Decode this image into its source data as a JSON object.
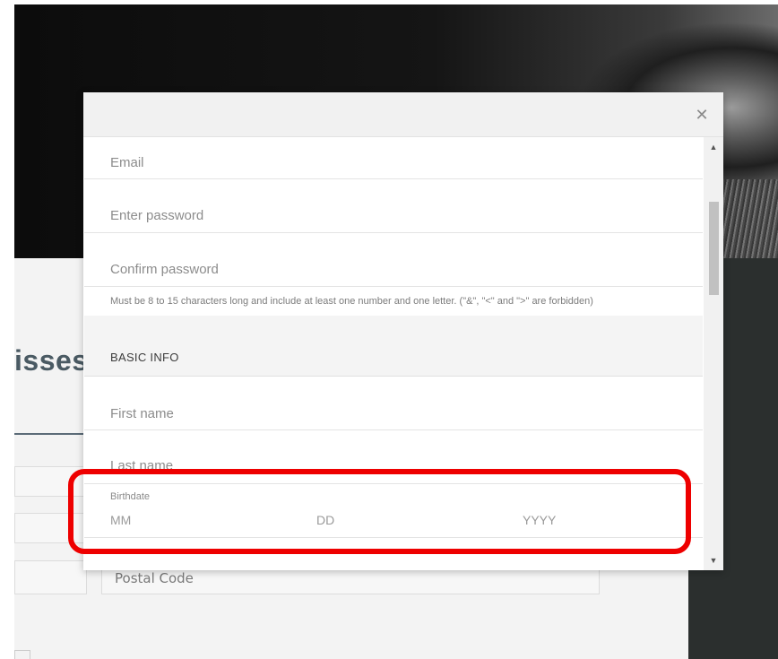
{
  "background": {
    "heading_fragment": "isses",
    "postal_code_placeholder": "Postal Code"
  },
  "modal": {
    "close_symbol": "✕",
    "fields": {
      "email_placeholder": "Email",
      "password_placeholder": "Enter password",
      "confirm_password_placeholder": "Confirm password",
      "password_hint": "Must be 8 to 15 characters long and include at least one number and one letter. (\"&\", \"<\" and \">\" are forbidden)"
    },
    "basic_info": {
      "section_title": "BASIC INFO",
      "first_name_placeholder": "First name",
      "last_name_placeholder": "Last name",
      "birthdate_label": "Birthdate",
      "birthdate_month_placeholder": "MM",
      "birthdate_day_placeholder": "DD",
      "birthdate_year_placeholder": "YYYY"
    },
    "scrollbar": {
      "up_arrow": "▲",
      "down_arrow": "▼"
    }
  },
  "colors": {
    "highlight": "#ee0000"
  }
}
